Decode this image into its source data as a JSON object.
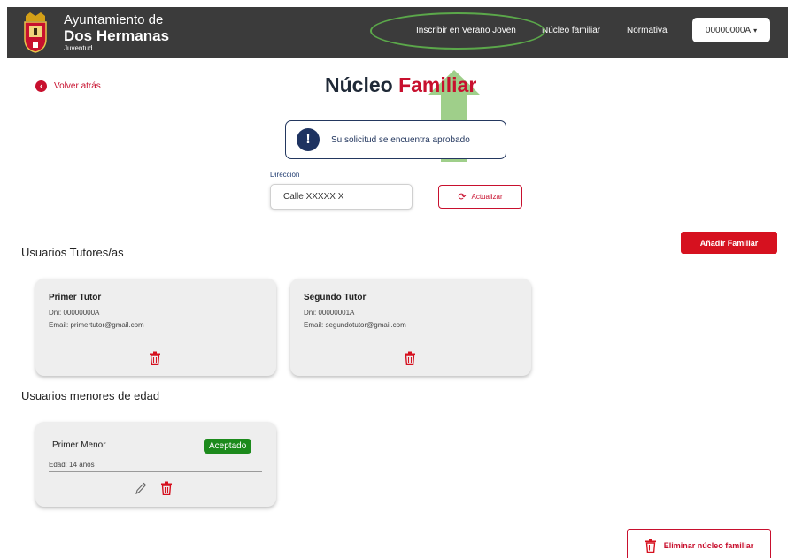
{
  "header": {
    "brand_line1": "Ayuntamiento de",
    "brand_line2": "Dos Hermanas",
    "brand_line3": "Juventud",
    "nav": [
      {
        "label": "Inscribir en Verano Joven"
      },
      {
        "label": "Núcleo familiar"
      },
      {
        "label": "Normativa"
      }
    ],
    "user_label": "00000000A",
    "user_caret": "▾"
  },
  "back": {
    "label": "Volver atrás",
    "icon": "arrow-left-circle-icon"
  },
  "page": {
    "title_part1": "Núcleo",
    "title_part2": "Familiar"
  },
  "alert": {
    "icon_glyph": "!",
    "text": "Su solicitud se encuentra aprobado"
  },
  "address": {
    "label": "Dirección",
    "value": "Calle XXXXX X"
  },
  "refresh": {
    "label": "Actualizar",
    "icon_glyph": "⟳"
  },
  "add_button": {
    "label": "Añadir Familiar"
  },
  "tutors": {
    "heading": "Usuarios Tutores/as",
    "items": [
      {
        "title": "Primer Tutor",
        "dni": "Dni: 00000000A",
        "email": "Email: primertutor@gmail.com"
      },
      {
        "title": "Segundo Tutor",
        "dni": "Dni: 00000001A",
        "email": "Email: segundotutor@gmail.com"
      }
    ]
  },
  "minors": {
    "heading": "Usuarios menores de edad",
    "items": [
      {
        "name": "Primer Menor",
        "age": "Edad: 14 años",
        "status": "Aceptado"
      }
    ]
  },
  "delete_button": {
    "label": "Eliminar núcleo familiar"
  },
  "colors": {
    "header_bg": "#3b3b3b",
    "accent_red": "#c8102e",
    "navy": "#1e3361",
    "success_green": "#1c8a1c",
    "annotation_green": "#5ba84a"
  }
}
